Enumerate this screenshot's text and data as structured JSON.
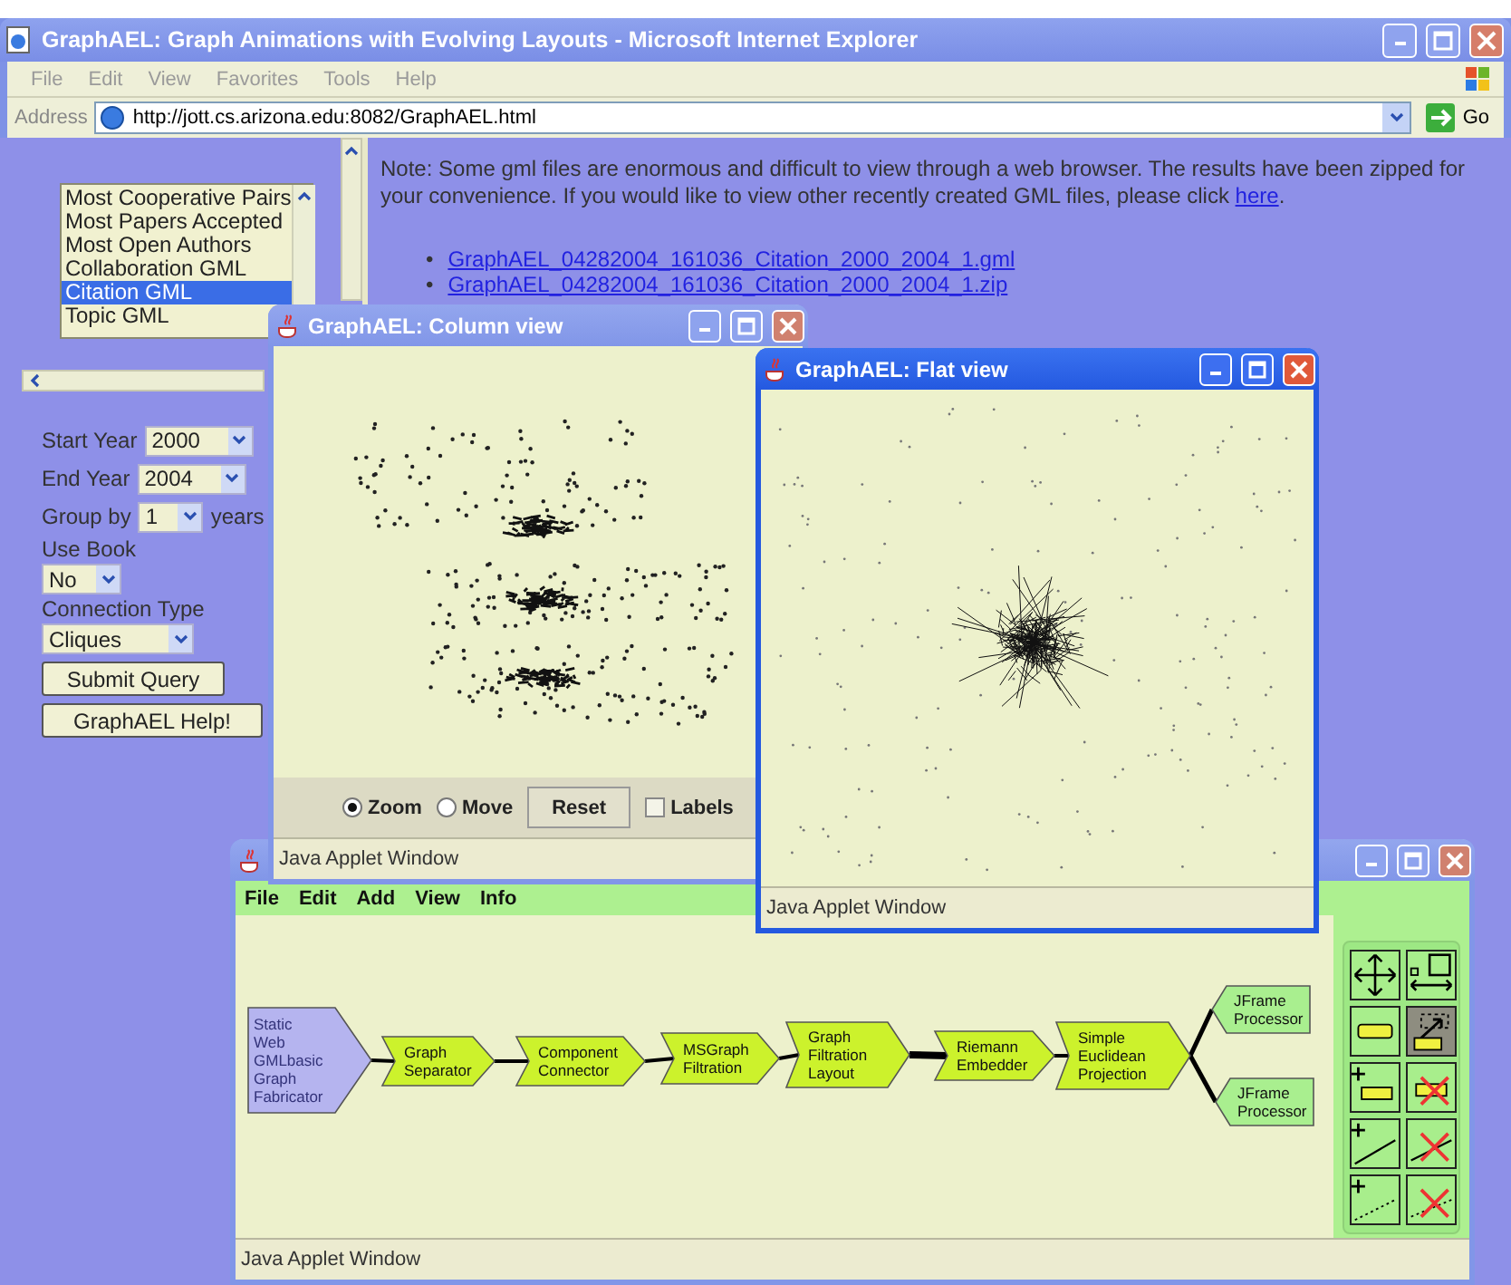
{
  "window": {
    "title": "GraphAEL: Graph Animations with Evolving Layouts - Microsoft Internet Explorer"
  },
  "menu": [
    "File",
    "Edit",
    "View",
    "Favorites",
    "Tools",
    "Help"
  ],
  "address_bar": {
    "label": "Address",
    "value": "http://jott.cs.arizona.edu:8082/GraphAEL.html",
    "go": "Go"
  },
  "query_list": [
    {
      "label": "Most Cooperative Pairs",
      "selected": false
    },
    {
      "label": "Most Papers Accepted",
      "selected": false
    },
    {
      "label": "Most Open Authors",
      "selected": false
    },
    {
      "label": "Collaboration GML",
      "selected": false
    },
    {
      "label": "Citation GML",
      "selected": true
    },
    {
      "label": "Topic GML",
      "selected": false
    }
  ],
  "form": {
    "fields": [
      {
        "kind": "inline",
        "label": "Start Year",
        "value": "2000"
      },
      {
        "kind": "inline",
        "label": "End Year",
        "value": "2004"
      },
      {
        "kind": "inline",
        "label": "Group by",
        "value": "1",
        "suffix": "years"
      },
      {
        "kind": "stacked",
        "label": "Use Book",
        "value": "No"
      },
      {
        "kind": "stacked",
        "label": "Connection Type",
        "value": "Cliques"
      }
    ],
    "buttons": [
      "Submit Query",
      "GraphAEL Help!"
    ]
  },
  "note": {
    "text": "Note: Some gml files are enormous and difficult to view through a web browser. The results have been zipped for your convenience. If you would like to view other recently created GML files, please click ",
    "link": "here",
    "end": "."
  },
  "files": [
    {
      "bullet": "•",
      "name": "GraphAEL_04282004_161036_Citation_2000_2004_1.gml"
    },
    {
      "bullet": "•",
      "name": "GraphAEL_04282004_161036_Citation_2000_2004_1.zip"
    }
  ],
  "column_view": {
    "title": "GraphAEL: Column view",
    "modes": [
      {
        "label": "Zoom",
        "selected": true
      },
      {
        "label": "Move",
        "selected": false
      }
    ],
    "reset": "Reset",
    "labels": {
      "label": "Labels",
      "checked": false
    },
    "status": "Java Applet Window"
  },
  "flat_view": {
    "title": "GraphAEL: Flat view",
    "status": "Java Applet Window"
  },
  "pipeline_window": {
    "menu": [
      "File",
      "Edit",
      "Add",
      "View",
      "Info"
    ],
    "nodes": [
      {
        "kind": "source",
        "lines": [
          "Static",
          "Web",
          "GMLbasic",
          "Graph",
          "Fabricator"
        ]
      },
      {
        "kind": "step",
        "lines": [
          "Graph",
          "Separator"
        ]
      },
      {
        "kind": "step",
        "lines": [
          "Component",
          "Connector"
        ]
      },
      {
        "kind": "step",
        "lines": [
          "MSGraph",
          "Filtration"
        ]
      },
      {
        "kind": "step",
        "lines": [
          "Graph",
          "Filtration",
          "Layout"
        ]
      },
      {
        "kind": "step",
        "lines": [
          "Riemann",
          "Embedder"
        ]
      },
      {
        "kind": "step",
        "lines": [
          "Simple",
          "Euclidean",
          "Projection"
        ]
      },
      {
        "kind": "sink",
        "lines": [
          "JFrame",
          "Processor"
        ]
      },
      {
        "kind": "sink",
        "lines": [
          "JFrame",
          "Processor"
        ]
      }
    ],
    "tools": [
      {
        "kind": "move",
        "selected": false
      },
      {
        "kind": "resize",
        "selected": false
      },
      {
        "kind": "node",
        "selected": false
      },
      {
        "kind": "select-node",
        "selected": true
      },
      {
        "kind": "add-node",
        "selected": false
      },
      {
        "kind": "delete-node",
        "selected": false
      },
      {
        "kind": "add-edge",
        "selected": false
      },
      {
        "kind": "delete-edge",
        "selected": false
      },
      {
        "kind": "add-dashed-edge",
        "selected": false
      },
      {
        "kind": "delete-dashed-edge",
        "selected": false
      }
    ],
    "status": "Java Applet Window"
  }
}
